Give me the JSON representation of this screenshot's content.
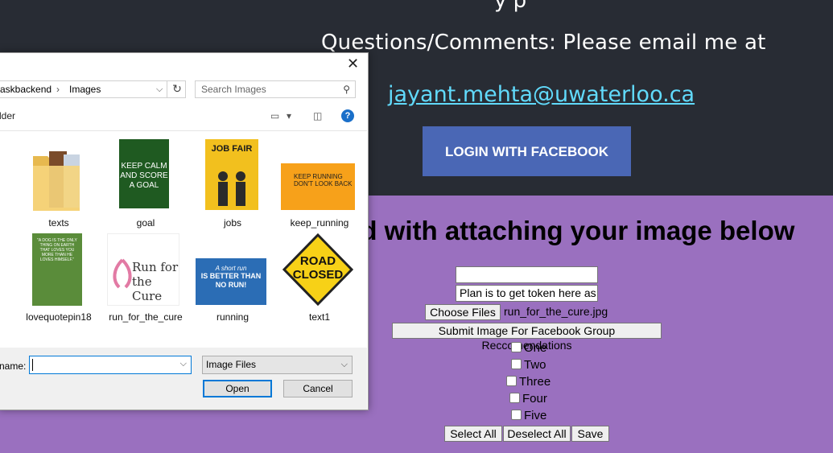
{
  "page": {
    "top_cut_text": "y p",
    "questions_text": "Questions/Comments: Please email me at",
    "email": "jayant.mehta@uwaterloo.ca",
    "fb_login": "LOGIN WITH FACEBOOK",
    "heading": "ed with attaching your image below",
    "text_input_value": "",
    "token_input_value": "Plan is to get token here as a",
    "choose_files": "Choose Files",
    "chosen_file": "run_for_the_cure.jpg",
    "submit": "Submit Image For Facebook Group Reccomendations",
    "options": [
      "One",
      "Two",
      "Three",
      "Four",
      "Five"
    ],
    "select_all": "Select All",
    "deselect_all": "Deselect All",
    "save": "Save",
    "colors": {
      "header_bg": "#282c34",
      "body_bg": "#9a70bf",
      "link": "#61dafb",
      "fb_button": "#4a67b5"
    }
  },
  "dialog": {
    "path_seg1": "askbackend",
    "path_seg2": "Images",
    "search_placeholder": "Search Images",
    "toolbar_left": "lder",
    "files": [
      {
        "name": "texts"
      },
      {
        "name": "goal"
      },
      {
        "name": "jobs"
      },
      {
        "name": "keep_running"
      },
      {
        "name": "lovequotepin18"
      },
      {
        "name": "run_for_the_cure"
      },
      {
        "name": "running"
      },
      {
        "name": "text1"
      }
    ],
    "thumb_text": {
      "goal": "KEEP CALM AND SCORE A GOAL",
      "jobs": "JOB FAIR",
      "keep_running": "KEEP RUNNING DON'T LOOK BACK",
      "lovequote": "\"A DOG IS THE ONLY THING ON EARTH THAT LOVES YOU MORE THAN HE LOVES HIMSELF.\"",
      "run_for_cure": "Run for the Cure",
      "running_small": "A short run",
      "running_big": "IS BETTER THAN NO RUN!",
      "road_closed": "ROAD CLOSED"
    },
    "filename_label": "name:",
    "filename_value": "",
    "file_type": "Image Files",
    "open": "Open",
    "cancel": "Cancel"
  }
}
